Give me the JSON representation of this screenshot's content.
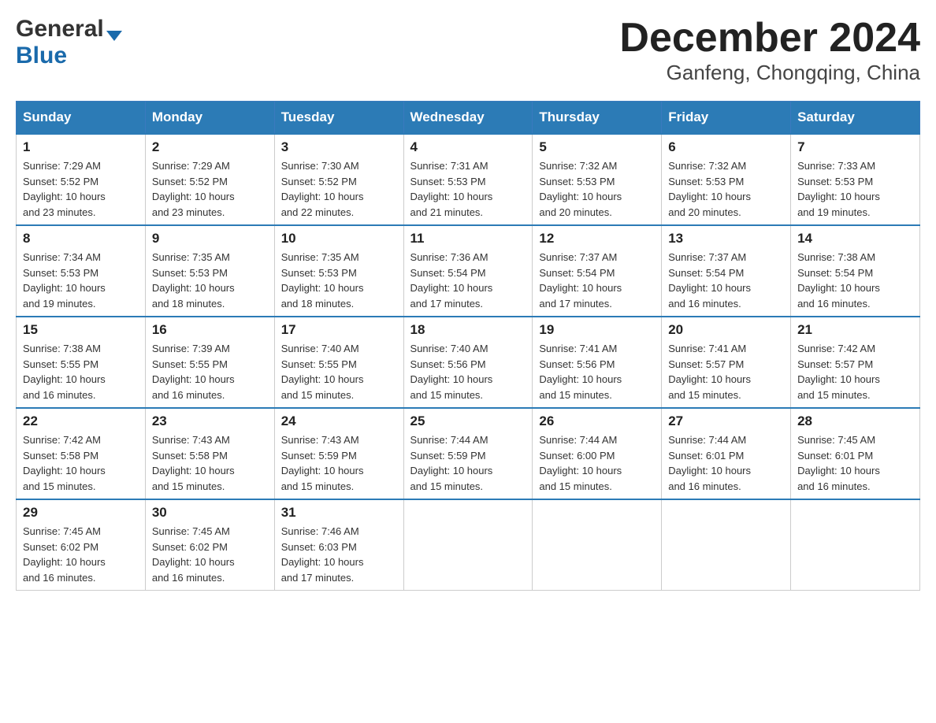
{
  "header": {
    "logo": {
      "general": "General",
      "blue": "Blue",
      "arrow": "▼"
    },
    "title": "December 2024",
    "location": "Ganfeng, Chongqing, China"
  },
  "columns": [
    "Sunday",
    "Monday",
    "Tuesday",
    "Wednesday",
    "Thursday",
    "Friday",
    "Saturday"
  ],
  "weeks": [
    [
      {
        "day": "1",
        "sunrise": "Sunrise: 7:29 AM",
        "sunset": "Sunset: 5:52 PM",
        "daylight": "Daylight: 10 hours",
        "daylight2": "and 23 minutes."
      },
      {
        "day": "2",
        "sunrise": "Sunrise: 7:29 AM",
        "sunset": "Sunset: 5:52 PM",
        "daylight": "Daylight: 10 hours",
        "daylight2": "and 23 minutes."
      },
      {
        "day": "3",
        "sunrise": "Sunrise: 7:30 AM",
        "sunset": "Sunset: 5:52 PM",
        "daylight": "Daylight: 10 hours",
        "daylight2": "and 22 minutes."
      },
      {
        "day": "4",
        "sunrise": "Sunrise: 7:31 AM",
        "sunset": "Sunset: 5:53 PM",
        "daylight": "Daylight: 10 hours",
        "daylight2": "and 21 minutes."
      },
      {
        "day": "5",
        "sunrise": "Sunrise: 7:32 AM",
        "sunset": "Sunset: 5:53 PM",
        "daylight": "Daylight: 10 hours",
        "daylight2": "and 20 minutes."
      },
      {
        "day": "6",
        "sunrise": "Sunrise: 7:32 AM",
        "sunset": "Sunset: 5:53 PM",
        "daylight": "Daylight: 10 hours",
        "daylight2": "and 20 minutes."
      },
      {
        "day": "7",
        "sunrise": "Sunrise: 7:33 AM",
        "sunset": "Sunset: 5:53 PM",
        "daylight": "Daylight: 10 hours",
        "daylight2": "and 19 minutes."
      }
    ],
    [
      {
        "day": "8",
        "sunrise": "Sunrise: 7:34 AM",
        "sunset": "Sunset: 5:53 PM",
        "daylight": "Daylight: 10 hours",
        "daylight2": "and 19 minutes."
      },
      {
        "day": "9",
        "sunrise": "Sunrise: 7:35 AM",
        "sunset": "Sunset: 5:53 PM",
        "daylight": "Daylight: 10 hours",
        "daylight2": "and 18 minutes."
      },
      {
        "day": "10",
        "sunrise": "Sunrise: 7:35 AM",
        "sunset": "Sunset: 5:53 PM",
        "daylight": "Daylight: 10 hours",
        "daylight2": "and 18 minutes."
      },
      {
        "day": "11",
        "sunrise": "Sunrise: 7:36 AM",
        "sunset": "Sunset: 5:54 PM",
        "daylight": "Daylight: 10 hours",
        "daylight2": "and 17 minutes."
      },
      {
        "day": "12",
        "sunrise": "Sunrise: 7:37 AM",
        "sunset": "Sunset: 5:54 PM",
        "daylight": "Daylight: 10 hours",
        "daylight2": "and 17 minutes."
      },
      {
        "day": "13",
        "sunrise": "Sunrise: 7:37 AM",
        "sunset": "Sunset: 5:54 PM",
        "daylight": "Daylight: 10 hours",
        "daylight2": "and 16 minutes."
      },
      {
        "day": "14",
        "sunrise": "Sunrise: 7:38 AM",
        "sunset": "Sunset: 5:54 PM",
        "daylight": "Daylight: 10 hours",
        "daylight2": "and 16 minutes."
      }
    ],
    [
      {
        "day": "15",
        "sunrise": "Sunrise: 7:38 AM",
        "sunset": "Sunset: 5:55 PM",
        "daylight": "Daylight: 10 hours",
        "daylight2": "and 16 minutes."
      },
      {
        "day": "16",
        "sunrise": "Sunrise: 7:39 AM",
        "sunset": "Sunset: 5:55 PM",
        "daylight": "Daylight: 10 hours",
        "daylight2": "and 16 minutes."
      },
      {
        "day": "17",
        "sunrise": "Sunrise: 7:40 AM",
        "sunset": "Sunset: 5:55 PM",
        "daylight": "Daylight: 10 hours",
        "daylight2": "and 15 minutes."
      },
      {
        "day": "18",
        "sunrise": "Sunrise: 7:40 AM",
        "sunset": "Sunset: 5:56 PM",
        "daylight": "Daylight: 10 hours",
        "daylight2": "and 15 minutes."
      },
      {
        "day": "19",
        "sunrise": "Sunrise: 7:41 AM",
        "sunset": "Sunset: 5:56 PM",
        "daylight": "Daylight: 10 hours",
        "daylight2": "and 15 minutes."
      },
      {
        "day": "20",
        "sunrise": "Sunrise: 7:41 AM",
        "sunset": "Sunset: 5:57 PM",
        "daylight": "Daylight: 10 hours",
        "daylight2": "and 15 minutes."
      },
      {
        "day": "21",
        "sunrise": "Sunrise: 7:42 AM",
        "sunset": "Sunset: 5:57 PM",
        "daylight": "Daylight: 10 hours",
        "daylight2": "and 15 minutes."
      }
    ],
    [
      {
        "day": "22",
        "sunrise": "Sunrise: 7:42 AM",
        "sunset": "Sunset: 5:58 PM",
        "daylight": "Daylight: 10 hours",
        "daylight2": "and 15 minutes."
      },
      {
        "day": "23",
        "sunrise": "Sunrise: 7:43 AM",
        "sunset": "Sunset: 5:58 PM",
        "daylight": "Daylight: 10 hours",
        "daylight2": "and 15 minutes."
      },
      {
        "day": "24",
        "sunrise": "Sunrise: 7:43 AM",
        "sunset": "Sunset: 5:59 PM",
        "daylight": "Daylight: 10 hours",
        "daylight2": "and 15 minutes."
      },
      {
        "day": "25",
        "sunrise": "Sunrise: 7:44 AM",
        "sunset": "Sunset: 5:59 PM",
        "daylight": "Daylight: 10 hours",
        "daylight2": "and 15 minutes."
      },
      {
        "day": "26",
        "sunrise": "Sunrise: 7:44 AM",
        "sunset": "Sunset: 6:00 PM",
        "daylight": "Daylight: 10 hours",
        "daylight2": "and 15 minutes."
      },
      {
        "day": "27",
        "sunrise": "Sunrise: 7:44 AM",
        "sunset": "Sunset: 6:01 PM",
        "daylight": "Daylight: 10 hours",
        "daylight2": "and 16 minutes."
      },
      {
        "day": "28",
        "sunrise": "Sunrise: 7:45 AM",
        "sunset": "Sunset: 6:01 PM",
        "daylight": "Daylight: 10 hours",
        "daylight2": "and 16 minutes."
      }
    ],
    [
      {
        "day": "29",
        "sunrise": "Sunrise: 7:45 AM",
        "sunset": "Sunset: 6:02 PM",
        "daylight": "Daylight: 10 hours",
        "daylight2": "and 16 minutes."
      },
      {
        "day": "30",
        "sunrise": "Sunrise: 7:45 AM",
        "sunset": "Sunset: 6:02 PM",
        "daylight": "Daylight: 10 hours",
        "daylight2": "and 16 minutes."
      },
      {
        "day": "31",
        "sunrise": "Sunrise: 7:46 AM",
        "sunset": "Sunset: 6:03 PM",
        "daylight": "Daylight: 10 hours",
        "daylight2": "and 17 minutes."
      },
      null,
      null,
      null,
      null
    ]
  ]
}
